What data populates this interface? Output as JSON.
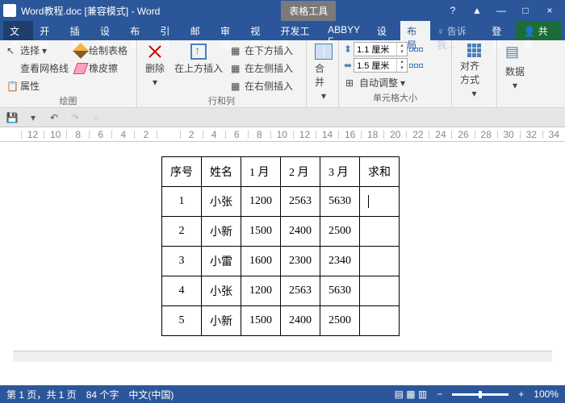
{
  "title": "Word教程.doc [兼容模式] - Word",
  "context_tab": "表格工具",
  "win": {
    "min": "—",
    "max": "□",
    "close": "×",
    "help": "?",
    "ribtoggle": "▲"
  },
  "tabs": {
    "file": "文件",
    "home": "开始",
    "insert": "插入",
    "design": "设计",
    "layout": "布局",
    "ref": "引用",
    "mail": "邮件",
    "review": "审阅",
    "view": "视图",
    "dev": "开发工具",
    "abbyy": "ABBYY F",
    "tdesign": "设计",
    "tlayout": "布局",
    "tell": "告诉我...",
    "login": "登录",
    "share": "共享"
  },
  "ribbon": {
    "g1": {
      "label": "绘图",
      "select": "选择",
      "view_grid": "查看网格线",
      "props": "属性",
      "draw": "绘制表格",
      "eraser": "橡皮擦"
    },
    "g2": {
      "label": "行和列",
      "delete": "删除",
      "ins_above": "在上方插入",
      "ins_below": "在下方插入",
      "ins_left": "在左侧插入",
      "ins_right": "在右侧插入"
    },
    "g3": {
      "label": "",
      "merge": "合并"
    },
    "g4": {
      "label": "单元格大小",
      "h": "1.1 厘米",
      "w": "1.5 厘米",
      "autofit": "自动调整"
    },
    "g5": {
      "align": "对齐方式",
      "data": "数据"
    }
  },
  "ruler_vals": [
    "12",
    "10",
    "8",
    "6",
    "4",
    "2",
    "",
    "2",
    "4",
    "6",
    "8",
    "10",
    "12",
    "14",
    "16",
    "18",
    "20",
    "22",
    "24",
    "26",
    "28",
    "30",
    "32",
    "34"
  ],
  "table": {
    "headers": [
      "序号",
      "姓名",
      "1 月",
      "2 月",
      "3 月",
      "求和"
    ],
    "rows": [
      [
        "1",
        "小张",
        "1200",
        "2563",
        "5630",
        ""
      ],
      [
        "2",
        "小新",
        "1500",
        "2400",
        "2500",
        ""
      ],
      [
        "3",
        "小雷",
        "1600",
        "2300",
        "2340",
        ""
      ],
      [
        "4",
        "小张",
        "1200",
        "2563",
        "5630",
        ""
      ],
      [
        "5",
        "小新",
        "1500",
        "2400",
        "2500",
        ""
      ]
    ]
  },
  "status": {
    "pages": "第 1 页，共 1 页",
    "words": "84 个字",
    "lang": "中文(中国)",
    "zoom": "100%"
  }
}
